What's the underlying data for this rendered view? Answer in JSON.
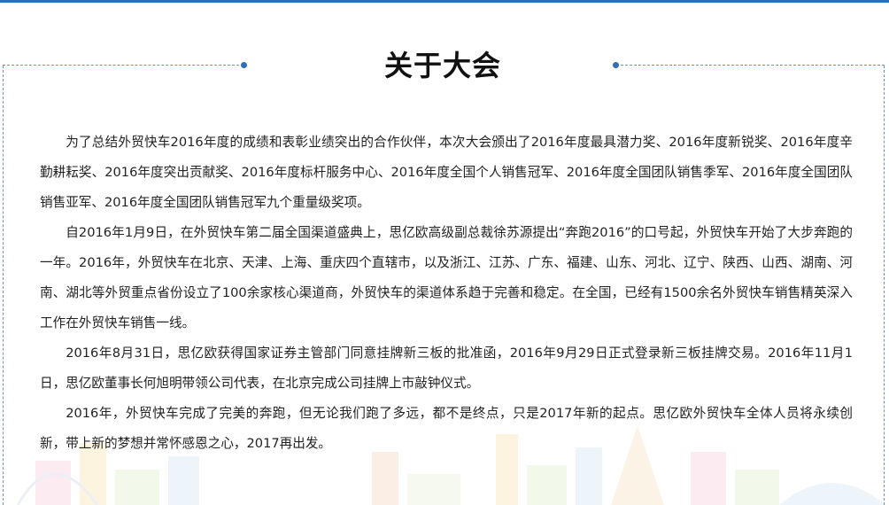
{
  "title": "关于大会",
  "paragraphs": [
    "为了总结外贸快车2016年度的成绩和表彰业绩突出的合作伙伴，本次大会颁出了2016年度最具潜力奖、2016年度新锐奖、2016年度辛勤耕耘奖、2016年度突出贡献奖、2016年度标杆服务中心、2016年度全国个人销售冠军、2016年度全国团队销售季军、2016年度全国团队销售亚军、2016年度全国团队销售冠军九个重量级奖项。",
    "自2016年1月9日，在外贸快车第二届全国渠道盛典上，思亿欧高级副总裁徐苏源提出“奔跑2016”的口号起，外贸快车开始了大步奔跑的一年。2016年，外贸快车在北京、天津、上海、重庆四个直辖市，以及浙江、江苏、广东、福建、山东、河北、辽宁、陕西、山西、湖南、河南、湖北等外贸重点省份设立了100余家核心渠道商，外贸快车的渠道体系趋于完善和稳定。在全国，已经有1500余名外贸快车销售精英深入工作在外贸快车销售一线。",
    "2016年8月31日，思亿欧获得国家证券主管部门同意挂牌新三板的批准函，2016年9月29日正式登录新三板挂牌交易。2016年11月1日，思亿欧董事长何旭明带领公司代表，在北京完成公司挂牌上市敲钟仪式。",
    "2016年，外贸快车完成了完美的奔跑，但无论我们跑了多远，都不是终点，只是2017年新的起点。思亿欧外贸快车全体人员将永续创新，带上新的梦想并常怀感恩之心，2017再出发。"
  ],
  "colors": {
    "accent": "#2f6fb3",
    "frame": "#6c93c4",
    "text": "#222222"
  }
}
